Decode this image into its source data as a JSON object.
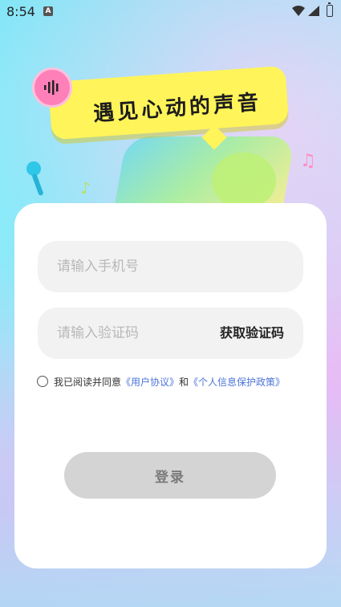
{
  "status_bar": {
    "time": "8:54",
    "notification_icon": "a-icon",
    "wifi_icon": "wifi-icon",
    "signal_icon": "signal-icon",
    "battery_icon": "battery-charging-icon"
  },
  "hero": {
    "title": "遇见心动的声音",
    "badge_icon": "soundwave-badge-icon",
    "decorations": [
      "microphone-icon",
      "music-note-icon",
      "stage-illustration"
    ]
  },
  "login": {
    "phone_placeholder": "请输入手机号",
    "phone_value": "",
    "code_placeholder": "请输入验证码",
    "code_value": "",
    "get_code_label": "获取验证码",
    "agreement": {
      "checked": false,
      "prefix": "我已阅读并同意",
      "user_agreement": "《用户协议》",
      "connector": "和",
      "privacy_policy": "《个人信息保护政策》"
    },
    "submit_label": "登录"
  },
  "colors": {
    "bubble": "#fff45a",
    "link": "#4c74d8",
    "button_disabled": "#d4d4d4",
    "input_bg": "#f2f2f2"
  }
}
